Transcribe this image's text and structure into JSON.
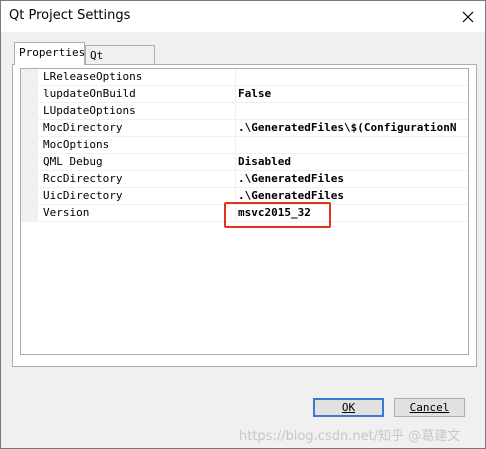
{
  "window": {
    "title": "Qt Project Settings"
  },
  "tabs": [
    {
      "label": "Properties",
      "active": true
    },
    {
      "label": "Qt Modules",
      "active": false
    }
  ],
  "properties": [
    {
      "name": "LReleaseOptions",
      "value": ""
    },
    {
      "name": "lupdateOnBuild",
      "value": "False"
    },
    {
      "name": "LUpdateOptions",
      "value": ""
    },
    {
      "name": "MocDirectory",
      "value": ".\\GeneratedFiles\\$(ConfigurationN"
    },
    {
      "name": "MocOptions",
      "value": ""
    },
    {
      "name": "QML Debug",
      "value": "Disabled"
    },
    {
      "name": "RccDirectory",
      "value": ".\\GeneratedFiles"
    },
    {
      "name": "UicDirectory",
      "value": ".\\GeneratedFiles"
    },
    {
      "name": "Version",
      "value": "msvc2015_32"
    }
  ],
  "buttons": {
    "ok": "OK",
    "cancel": "Cancel"
  },
  "watermark": "https://blog.csdn.net/知乎 @葛建文",
  "colors": {
    "highlight": "#e0301e",
    "ok_border": "#3979d3"
  }
}
